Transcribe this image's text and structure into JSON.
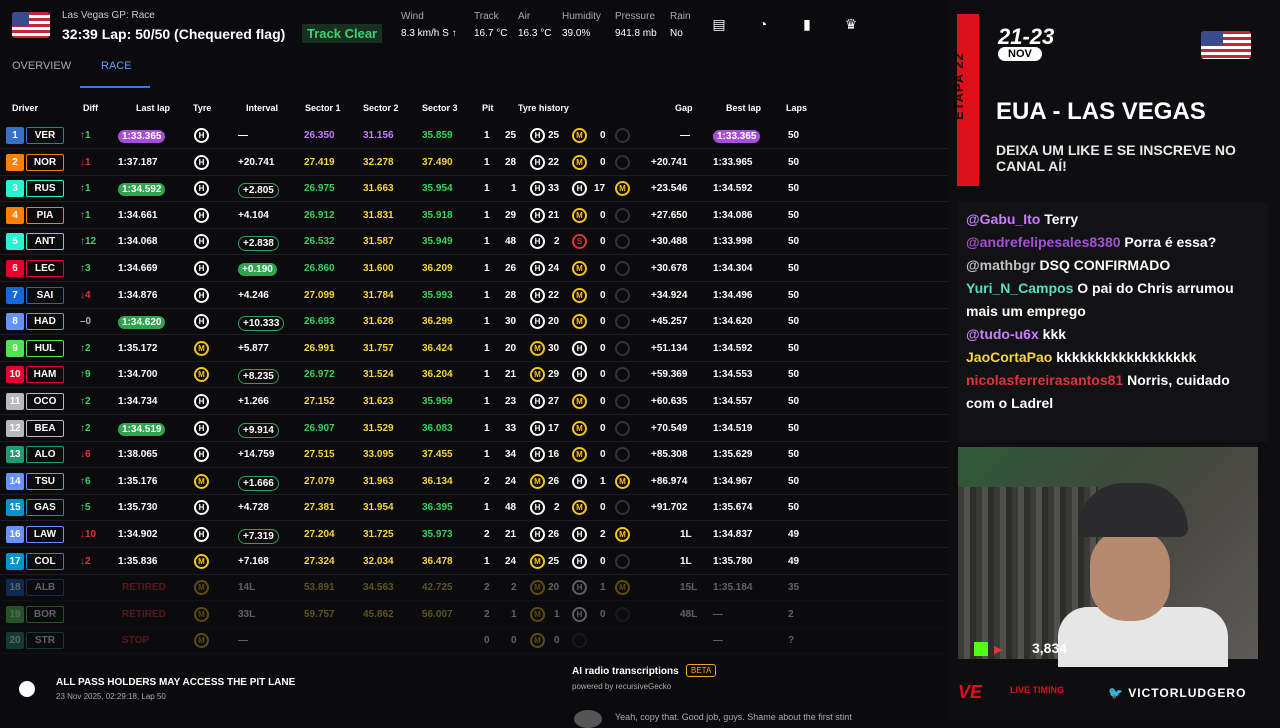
{
  "header": {
    "gp": "Las Vegas GP: Race",
    "lap": "32:39 Lap: 50/50 (Chequered flag)",
    "track_status": "Track Clear",
    "weather": [
      {
        "label": "Wind",
        "value": "8.3 km/h S ↑"
      },
      {
        "label": "Track",
        "value": "16.7 °C"
      },
      {
        "label": "Air",
        "value": "16.3 °C"
      },
      {
        "label": "Humidity",
        "value": "39.0%"
      },
      {
        "label": "Pressure",
        "value": "941.8 mb"
      },
      {
        "label": "Rain",
        "value": "No"
      }
    ]
  },
  "tabs": [
    "OVERVIEW",
    "RACE"
  ],
  "columns": [
    "Driver",
    "Diff",
    "Last lap",
    "Tyre",
    "Interval",
    "Sector 1",
    "Sector 2",
    "Sector 3",
    "Pit",
    "Tyre history",
    "Gap",
    "Best lap",
    "Laps"
  ],
  "rows": [
    {
      "pos": "1",
      "abbr": "VER",
      "team": "#3671c6",
      "diff": "↑1",
      "dir": "up",
      "last": "1:33.365",
      "lastc": "pur",
      "tyre": "H",
      "int": "—",
      "intc": "",
      "s1": "26.350",
      "s1c": "pur",
      "s2": "31.156",
      "s2c": "pur",
      "s3": "35.859",
      "s3c": "grn",
      "pit": "1",
      "hist": [
        [
          "25",
          "H"
        ],
        [
          "25",
          "M"
        ],
        [
          "0",
          "E"
        ]
      ],
      "gap": "—",
      "best": "1:33.365",
      "bestc": "pur",
      "laps": "50"
    },
    {
      "pos": "2",
      "abbr": "NOR",
      "team": "#ff8000",
      "diff": "↓1",
      "dir": "dn",
      "last": "1:37.187",
      "lastc": "",
      "tyre": "H",
      "int": "+20.741",
      "intc": "",
      "s1": "27.419",
      "s1c": "yel",
      "s2": "32.278",
      "s2c": "yel",
      "s3": "37.490",
      "s3c": "yel",
      "pit": "1",
      "hist": [
        [
          "28",
          "H"
        ],
        [
          "22",
          "M"
        ],
        [
          "0",
          "E"
        ]
      ],
      "gap": "+20.741",
      "best": "1:33.965",
      "bestc": "",
      "laps": "50"
    },
    {
      "pos": "3",
      "abbr": "RUS",
      "team": "#27f4d2",
      "diff": "↑1",
      "dir": "up",
      "last": "1:34.592",
      "lastc": "grn",
      "tyre": "H",
      "int": "+2.805",
      "intc": "ogrn",
      "s1": "26.975",
      "s1c": "grn",
      "s2": "31.663",
      "s2c": "yel",
      "s3": "35.954",
      "s3c": "grn",
      "pit": "1",
      "hist": [
        [
          "1",
          "H"
        ],
        [
          "33",
          "H"
        ],
        [
          "17",
          "M"
        ]
      ],
      "gap": "+23.546",
      "best": "1:34.592",
      "bestc": "",
      "laps": "50"
    },
    {
      "pos": "4",
      "abbr": "PIA",
      "team": "#ff8000",
      "diff": "↑1",
      "dir": "up",
      "last": "1:34.661",
      "lastc": "",
      "tyre": "H",
      "int": "+4.104",
      "intc": "",
      "s1": "26.912",
      "s1c": "grn",
      "s2": "31.831",
      "s2c": "yel",
      "s3": "35.918",
      "s3c": "grn",
      "pit": "1",
      "hist": [
        [
          "29",
          "H"
        ],
        [
          "21",
          "M"
        ],
        [
          "0",
          "E"
        ]
      ],
      "gap": "+27.650",
      "best": "1:34.086",
      "bestc": "",
      "laps": "50"
    },
    {
      "pos": "5",
      "abbr": "ANT",
      "team": "#27f4d2",
      "diff": "↑12",
      "dir": "up",
      "last": "1:34.068",
      "lastc": "",
      "tyre": "H",
      "int": "+2.838",
      "intc": "ogrn",
      "s1": "26.532",
      "s1c": "grn",
      "s2": "31.587",
      "s2c": "yel",
      "s3": "35.949",
      "s3c": "grn",
      "pit": "1",
      "hist": [
        [
          "48",
          "H"
        ],
        [
          "2",
          "S"
        ],
        [
          "0",
          "E"
        ]
      ],
      "gap": "+30.488",
      "best": "1:33.998",
      "bestc": "",
      "laps": "50"
    },
    {
      "pos": "6",
      "abbr": "LEC",
      "team": "#e8002d",
      "diff": "↑3",
      "dir": "up",
      "last": "1:34.669",
      "lastc": "",
      "tyre": "H",
      "int": "+0.190",
      "intc": "grn",
      "s1": "26.860",
      "s1c": "grn",
      "s2": "31.600",
      "s2c": "yel",
      "s3": "36.209",
      "s3c": "yel",
      "pit": "1",
      "hist": [
        [
          "26",
          "H"
        ],
        [
          "24",
          "M"
        ],
        [
          "0",
          "E"
        ]
      ],
      "gap": "+30.678",
      "best": "1:34.304",
      "bestc": "",
      "laps": "50"
    },
    {
      "pos": "7",
      "abbr": "SAI",
      "team": "#1868db",
      "diff": "↓4",
      "dir": "dn",
      "last": "1:34.876",
      "lastc": "",
      "tyre": "H",
      "int": "+4.246",
      "intc": "",
      "s1": "27.099",
      "s1c": "yel",
      "s2": "31.784",
      "s2c": "yel",
      "s3": "35.993",
      "s3c": "grn",
      "pit": "1",
      "hist": [
        [
          "28",
          "H"
        ],
        [
          "22",
          "M"
        ],
        [
          "0",
          "E"
        ]
      ],
      "gap": "+34.924",
      "best": "1:34.496",
      "bestc": "",
      "laps": "50"
    },
    {
      "pos": "8",
      "abbr": "HAD",
      "team": "#6692ff",
      "diff": "–0",
      "dir": "eq",
      "last": "1:34.620",
      "lastc": "grn",
      "tyre": "H",
      "int": "+10.333",
      "intc": "ogrn",
      "s1": "26.693",
      "s1c": "grn",
      "s2": "31.628",
      "s2c": "yel",
      "s3": "36.299",
      "s3c": "yel",
      "pit": "1",
      "hist": [
        [
          "30",
          "H"
        ],
        [
          "20",
          "M"
        ],
        [
          "0",
          "E"
        ]
      ],
      "gap": "+45.257",
      "best": "1:34.620",
      "bestc": "",
      "laps": "50"
    },
    {
      "pos": "9",
      "abbr": "HUL",
      "team": "#52e252",
      "diff": "↑2",
      "dir": "up",
      "last": "1:35.172",
      "lastc": "",
      "tyre": "M",
      "int": "+5.877",
      "intc": "",
      "s1": "26.991",
      "s1c": "yel",
      "s2": "31.757",
      "s2c": "yel",
      "s3": "36.424",
      "s3c": "yel",
      "pit": "1",
      "hist": [
        [
          "20",
          "M"
        ],
        [
          "30",
          "H"
        ],
        [
          "0",
          "E"
        ]
      ],
      "gap": "+51.134",
      "best": "1:34.592",
      "bestc": "",
      "laps": "50"
    },
    {
      "pos": "10",
      "abbr": "HAM",
      "team": "#e8002d",
      "diff": "↑9",
      "dir": "up",
      "last": "1:34.700",
      "lastc": "",
      "tyre": "M",
      "int": "+8.235",
      "intc": "ogrn",
      "s1": "26.972",
      "s1c": "grn",
      "s2": "31.524",
      "s2c": "yel",
      "s3": "36.204",
      "s3c": "yel",
      "pit": "1",
      "hist": [
        [
          "21",
          "M"
        ],
        [
          "29",
          "H"
        ],
        [
          "0",
          "E"
        ]
      ],
      "gap": "+59.369",
      "best": "1:34.553",
      "bestc": "",
      "laps": "50"
    },
    {
      "pos": "11",
      "abbr": "OCO",
      "team": "#b6babd",
      "diff": "↑2",
      "dir": "up",
      "last": "1:34.734",
      "lastc": "",
      "tyre": "H",
      "int": "+1.266",
      "intc": "",
      "s1": "27.152",
      "s1c": "yel",
      "s2": "31.623",
      "s2c": "yel",
      "s3": "35.959",
      "s3c": "grn",
      "pit": "1",
      "hist": [
        [
          "23",
          "H"
        ],
        [
          "27",
          "M"
        ],
        [
          "0",
          "E"
        ]
      ],
      "gap": "+60.635",
      "best": "1:34.557",
      "bestc": "",
      "laps": "50"
    },
    {
      "pos": "12",
      "abbr": "BEA",
      "team": "#b6babd",
      "diff": "↑2",
      "dir": "up",
      "last": "1:34.519",
      "lastc": "grn",
      "tyre": "H",
      "int": "+9.914",
      "intc": "ogrn",
      "s1": "26.907",
      "s1c": "grn",
      "s2": "31.529",
      "s2c": "yel",
      "s3": "36.083",
      "s3c": "grn",
      "pit": "1",
      "hist": [
        [
          "33",
          "H"
        ],
        [
          "17",
          "M"
        ],
        [
          "0",
          "E"
        ]
      ],
      "gap": "+70.549",
      "best": "1:34.519",
      "bestc": "",
      "laps": "50"
    },
    {
      "pos": "13",
      "abbr": "ALO",
      "team": "#229971",
      "diff": "↓6",
      "dir": "dn",
      "last": "1:38.065",
      "lastc": "",
      "tyre": "H",
      "int": "+14.759",
      "intc": "",
      "s1": "27.515",
      "s1c": "yel",
      "s2": "33.095",
      "s2c": "yel",
      "s3": "37.455",
      "s3c": "yel",
      "pit": "1",
      "hist": [
        [
          "34",
          "H"
        ],
        [
          "16",
          "M"
        ],
        [
          "0",
          "E"
        ]
      ],
      "gap": "+85.308",
      "best": "1:35.629",
      "bestc": "",
      "laps": "50"
    },
    {
      "pos": "14",
      "abbr": "TSU",
      "team": "#6692ff",
      "diff": "↑6",
      "dir": "up",
      "last": "1:35.176",
      "lastc": "",
      "tyre": "M",
      "int": "+1.666",
      "intc": "ogrn",
      "s1": "27.079",
      "s1c": "yel",
      "s2": "31.963",
      "s2c": "yel",
      "s3": "36.134",
      "s3c": "yel",
      "pit": "2",
      "hist": [
        [
          "24",
          "M"
        ],
        [
          "26",
          "H"
        ],
        [
          "1",
          "M"
        ]
      ],
      "gap": "+86.974",
      "best": "1:34.967",
      "bestc": "",
      "laps": "50"
    },
    {
      "pos": "15",
      "abbr": "GAS",
      "team": "#0093cc",
      "diff": "↑5",
      "dir": "up",
      "last": "1:35.730",
      "lastc": "",
      "tyre": "H",
      "int": "+4.728",
      "intc": "",
      "s1": "27.381",
      "s1c": "yel",
      "s2": "31.954",
      "s2c": "yel",
      "s3": "36.395",
      "s3c": "grn",
      "pit": "1",
      "hist": [
        [
          "48",
          "H"
        ],
        [
          "2",
          "M"
        ],
        [
          "0",
          "E"
        ]
      ],
      "gap": "+91.702",
      "best": "1:35.674",
      "bestc": "",
      "laps": "50"
    },
    {
      "pos": "16",
      "abbr": "LAW",
      "team": "#6692ff",
      "diff": "↓10",
      "dir": "dn",
      "last": "1:34.902",
      "lastc": "",
      "tyre": "H",
      "int": "+7.319",
      "intc": "ogrn",
      "s1": "27.204",
      "s1c": "yel",
      "s2": "31.725",
      "s2c": "yel",
      "s3": "35.973",
      "s3c": "grn",
      "pit": "2",
      "hist": [
        [
          "21",
          "H"
        ],
        [
          "26",
          "H"
        ],
        [
          "2",
          "M"
        ]
      ],
      "gap": "1L",
      "best": "1:34.837",
      "bestc": "",
      "laps": "49"
    },
    {
      "pos": "17",
      "abbr": "COL",
      "team": "#0093cc",
      "diff": "↓2",
      "dir": "dn",
      "last": "1:35.836",
      "lastc": "",
      "tyre": "M",
      "int": "+7.168",
      "intc": "",
      "s1": "27.324",
      "s1c": "yel",
      "s2": "32.034",
      "s2c": "yel",
      "s3": "36.478",
      "s3c": "yel",
      "pit": "1",
      "hist": [
        [
          "24",
          "M"
        ],
        [
          "25",
          "H"
        ],
        [
          "0",
          "E"
        ]
      ],
      "gap": "1L",
      "best": "1:35.780",
      "bestc": "",
      "laps": "49"
    },
    {
      "pos": "18",
      "abbr": "ALB",
      "team": "#1868db",
      "diff": "",
      "dir": "eq",
      "last": "RETIRED",
      "lastc": "ret",
      "tyre": "M",
      "int": "14L",
      "intc": "",
      "s1": "53.891",
      "s1c": "yel",
      "s2": "34.563",
      "s2c": "yel",
      "s3": "42.725",
      "s3c": "yel",
      "pit": "2",
      "hist": [
        [
          "2",
          "M"
        ],
        [
          "20",
          "H"
        ],
        [
          "1",
          "M"
        ]
      ],
      "gap": "15L",
      "best": "1:35.184",
      "bestc": "",
      "laps": "35",
      "dim": true
    },
    {
      "pos": "19",
      "abbr": "BOR",
      "team": "#52e252",
      "diff": "",
      "dir": "eq",
      "last": "RETIRED",
      "lastc": "ret",
      "tyre": "M",
      "int": "33L",
      "intc": "",
      "s1": "59.757",
      "s1c": "yel",
      "s2": "45.862",
      "s2c": "yel",
      "s3": "56.007",
      "s3c": "yel",
      "pit": "2",
      "hist": [
        [
          "1",
          "M"
        ],
        [
          "1",
          "H"
        ],
        [
          "0",
          "E"
        ]
      ],
      "gap": "48L",
      "best": "—",
      "bestc": "",
      "laps": "2",
      "dim": true
    },
    {
      "pos": "20",
      "abbr": "STR",
      "team": "#229971",
      "diff": "",
      "dir": "eq",
      "last": "STOP",
      "lastc": "ret",
      "tyre": "M",
      "int": "—",
      "intc": "",
      "s1": "",
      "s1c": "",
      "s2": "",
      "s2c": "",
      "s3": "",
      "s3c": "",
      "pit": "0",
      "hist": [
        [
          "0",
          "M"
        ],
        [
          "0",
          "E"
        ],
        [
          "",
          ""
        ]
      ],
      "gap": "",
      "best": "—",
      "bestc": "",
      "laps": "?",
      "dim": true
    }
  ],
  "footer": {
    "message": "ALL PASS HOLDERS MAY ACCESS THE PIT LANE",
    "message_time": "23 Nov 2025, 02:29:18, Lap 50",
    "ai_title": "AI radio transcriptions",
    "ai_badge": "BETA",
    "ai_powered": "powered by recursiveGecko",
    "radio_text": "Yeah, copy that. Good job, guys. Shame about the first stint"
  },
  "overlay": {
    "etapa": "ETAPA 22",
    "dates": "21-23",
    "month": "NOV",
    "city": "EUA - LAS VEGAS",
    "cta": "DEIXA UM LIKE E SE INSCREVE NO CANAL AÍ!"
  },
  "chat": [
    {
      "user": "@Gabu_Ito",
      "color": "#c77dff",
      "text": "Terry"
    },
    {
      "user": "@andrefelipesales8380",
      "color": "#a64fd6",
      "text": "Porra é essa?"
    },
    {
      "user": "@mathbgr",
      "color": "#c0c0c0",
      "text": "DSQ CONFIRMADO"
    },
    {
      "user": "Yuri_N_Campos",
      "color": "#57e0c0",
      "text": "O pai do Chris arrumou mais um emprego"
    },
    {
      "user": "@tudo-u6x",
      "color": "#c77dff",
      "text": "kkk"
    },
    {
      "user": "JaoCortaPao",
      "color": "#f5d63b",
      "text": "kkkkkkkkkkkkkkkkkk"
    },
    {
      "user": "nicolasferreirasantos81",
      "color": "#e0333c",
      "text": "Norris, cuidado com o Ladrel"
    }
  ],
  "stream": {
    "viewers": "3,834",
    "brand": "LIVE TIMING",
    "twitter": "VICTORLUDGERO"
  }
}
